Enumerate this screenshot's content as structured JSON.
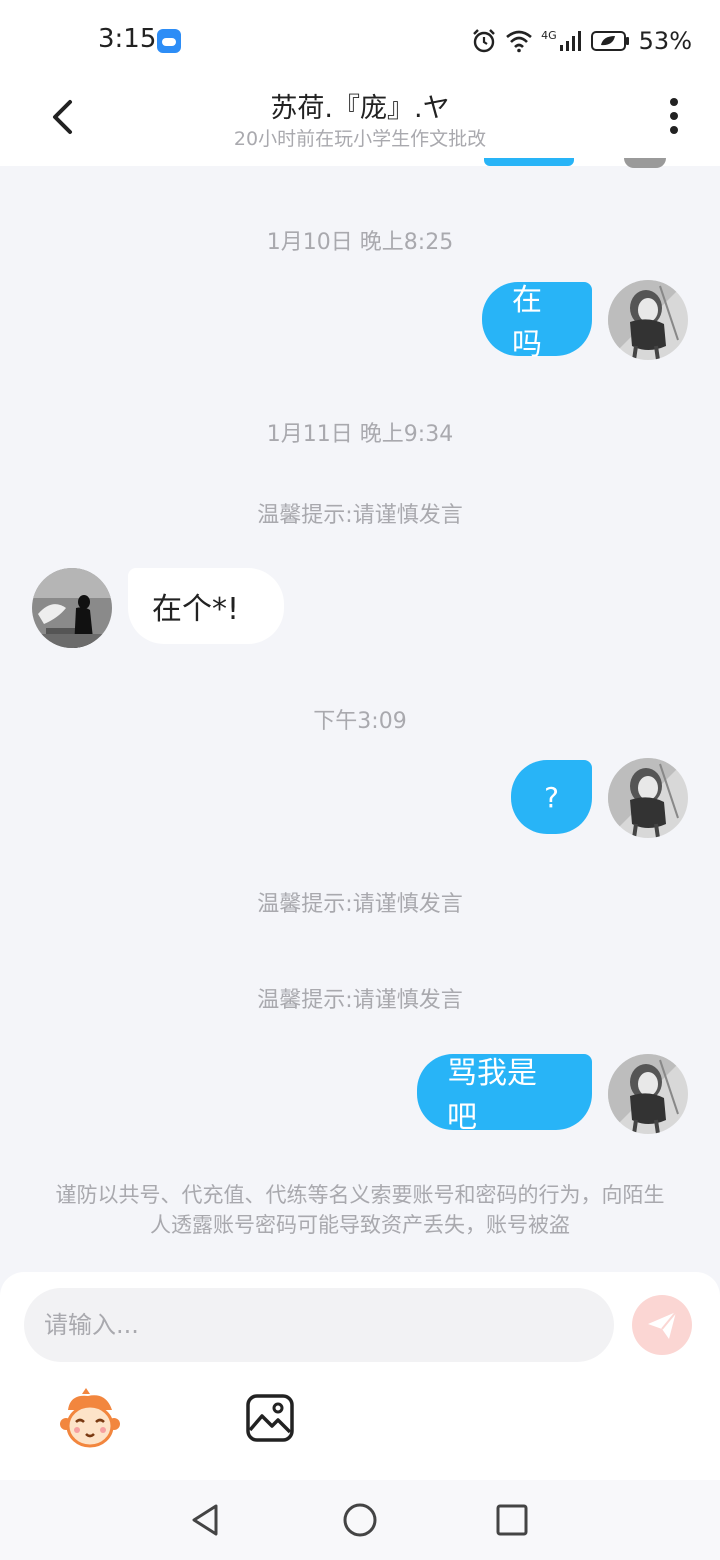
{
  "status_bar": {
    "time": "3:15",
    "network": "4G",
    "battery": "53%",
    "icons": [
      "weather-icon",
      "alarm-icon",
      "wifi-icon",
      "signal-icon",
      "battery-icon"
    ]
  },
  "header": {
    "title": "苏荷.『庞』.ヤ",
    "subtitle": "20小时前在玩小学生作文批改"
  },
  "chat": {
    "timestamps": [
      "1月10日 晚上8:25",
      "1月11日 晚上9:34",
      "下午3:09"
    ],
    "tip_text": "温馨提示:请谨慎发言",
    "messages": [
      {
        "side": "out",
        "text": "在吗"
      },
      {
        "side": "in",
        "text": "在个*!"
      },
      {
        "side": "out",
        "text": "?"
      },
      {
        "side": "out",
        "text": "骂我是吧"
      }
    ],
    "security_notice": "谨防以共号、代充值、代练等名义索要账号和密码的行为，向陌生人透露账号密码可能导致资产丢失，账号被盗"
  },
  "input_panel": {
    "placeholder": "请输入...",
    "send_color": "#fbd6d3",
    "tools": [
      "emoji-icon",
      "image-icon"
    ]
  },
  "colors": {
    "accent_blue": "#28b4f7",
    "background": "#f4f5f9",
    "muted_text": "#a9a9ae"
  }
}
